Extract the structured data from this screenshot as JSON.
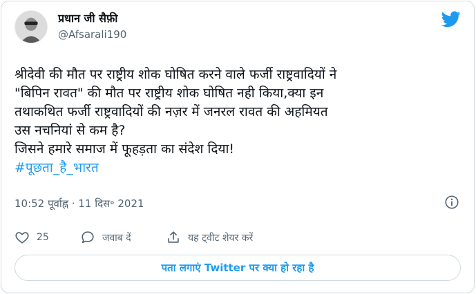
{
  "author": {
    "display_name": "प्रधान जी सैफ़ी",
    "handle": "@Afsarali190"
  },
  "tweet": {
    "lines": [
      "श्रीदेवी की मौत पर राष्ट्रीय शोक घोषित करने वाले फर्जी राष्ट्रवादियों ने",
      "\"बिपिन रावत\" की मौत पर राष्ट्रीय शोक घोषित नही किया,क्या इन",
      "तथाकथित फर्जी राष्ट्रवादियों की नज़र में जनरल रावत की अहमियत",
      "उस नचनियां से कम है?",
      "जिसने हमारे समाज में फूहड़ता का संदेश दिया!"
    ],
    "hashtag": "#पूछता_है_भारत",
    "timestamp": "10:52 पूर्वाह्न · 11 दिस॰ 2021"
  },
  "actions": {
    "like_count": "25",
    "reply_label": "जवाब दें",
    "share_label": "यह ट्वीट शेयर करें"
  },
  "explore_button": {
    "label": "पता लगाएं Twitter पर क्या हो रहा है"
  },
  "colors": {
    "accent": "#1d9bf0",
    "text": "#0f1419",
    "secondary": "#536471",
    "border": "#cfd9de"
  },
  "icons": [
    "twitter-bird-icon",
    "info-icon",
    "heart-icon",
    "reply-bubble-icon",
    "share-upload-icon"
  ]
}
